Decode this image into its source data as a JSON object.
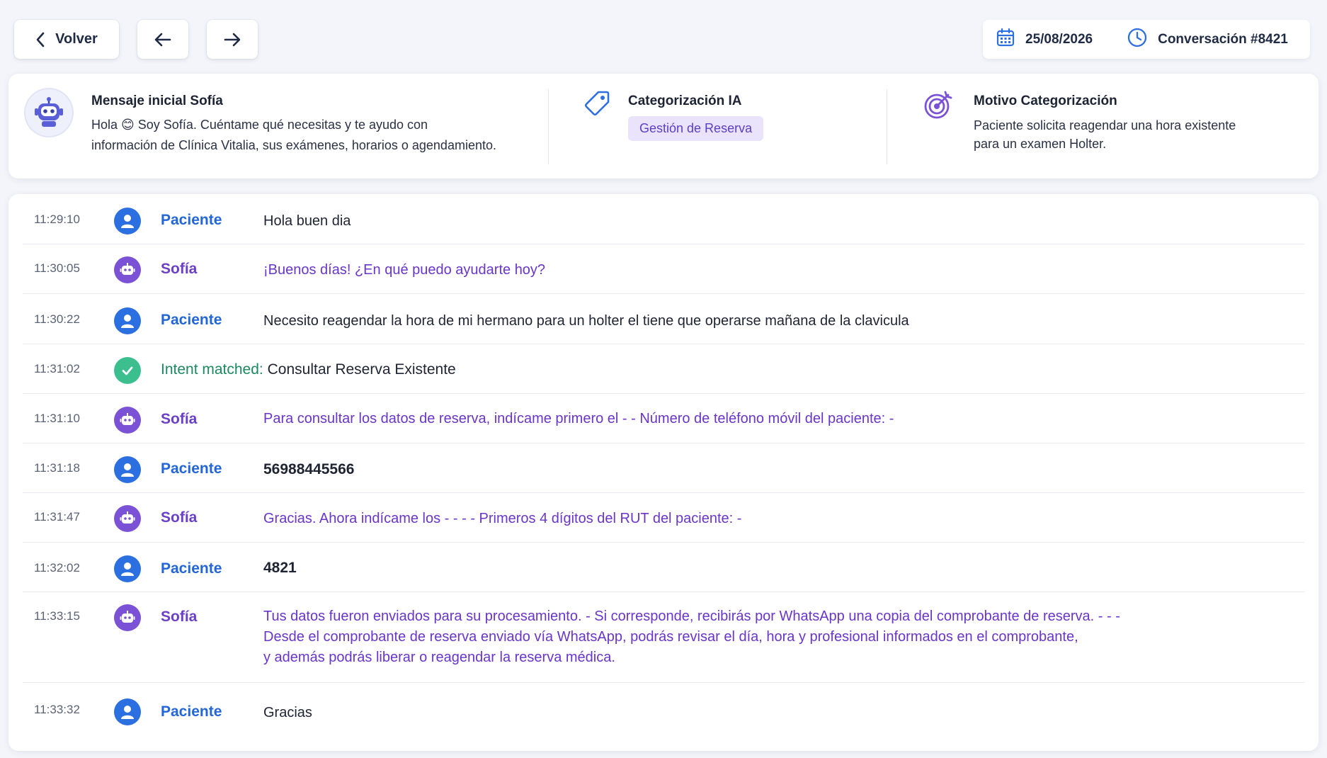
{
  "toolbar": {
    "back_label": "Volver",
    "date": "25/08/2026",
    "conversation": "Conversación #8421"
  },
  "summary": {
    "initial": {
      "title": "Mensaje inicial Sofía",
      "line1": "Hola 😊 Soy Sofía.  Cuéntame qué necesitas y te ayudo con",
      "line2": "información de Clínica Vitalia, sus exámenes, horarios o agendamiento."
    },
    "category": {
      "title": "Categorización IA",
      "tag": "Gestión de Reserva"
    },
    "reason": {
      "title": "Motivo Categorización",
      "line1": "Paciente solicita reagendar una hora existente",
      "line2": "para un examen Holter."
    }
  },
  "messages": [
    {
      "time": "11:29:10",
      "sender": "Paciente",
      "text": "Hola buen dia"
    },
    {
      "time": "11:30:05",
      "sender": "Sofía",
      "text": "¡Buenos días! ¿En qué puedo ayudarte hoy?"
    },
    {
      "time": "11:30:22",
      "sender": "Paciente",
      "text": "Necesito reagendar la hora de mi hermano para un holter el tiene que operarse mañana de la clavicula"
    },
    {
      "time": "11:31:02",
      "intent_label": "Intent matched:",
      "intent_value": "Consultar Reserva Existente"
    },
    {
      "time": "11:31:10",
      "sender": "Sofía",
      "text": "Para consultar los datos de reserva, indícame primero el - - Número de teléfono móvil del paciente: -"
    },
    {
      "time": "11:31:18",
      "sender": "Paciente",
      "text": "56988445566"
    },
    {
      "time": "11:31:47",
      "sender": "Sofía",
      "text": "Gracias. Ahora indícame los  -  -  -  - Primeros 4 dígitos del RUT del paciente: -"
    },
    {
      "time": "11:32:02",
      "sender": "Paciente",
      "text": "4821"
    },
    {
      "time": "11:33:15",
      "sender": "Sofía",
      "line1": "Tus datos fueron enviados para su procesamiento. - Si corresponde, recibirás por WhatsApp una copia del comprobante de reserva.  -  -  -",
      "line2": "Desde el comprobante de reserva enviado vía WhatsApp, podrás revisar el día, hora y profesional informados en el comprobante,",
      "line3": "y además podrás liberar o reagendar la reserva médica."
    },
    {
      "time": "11:33:32",
      "sender": "Paciente",
      "text": "Gracias"
    }
  ],
  "colors": {
    "patient": "#2266d8",
    "bot": "#6b3fc8",
    "intent": "#1c8a5f",
    "tag_bg": "#e9e3fb"
  },
  "icons": [
    "chevron-left-icon",
    "arrow-left-icon",
    "arrow-right-icon",
    "calendar-icon",
    "clock-icon",
    "robot-icon",
    "tag-icon",
    "target-icon",
    "user-icon",
    "check-icon"
  ]
}
